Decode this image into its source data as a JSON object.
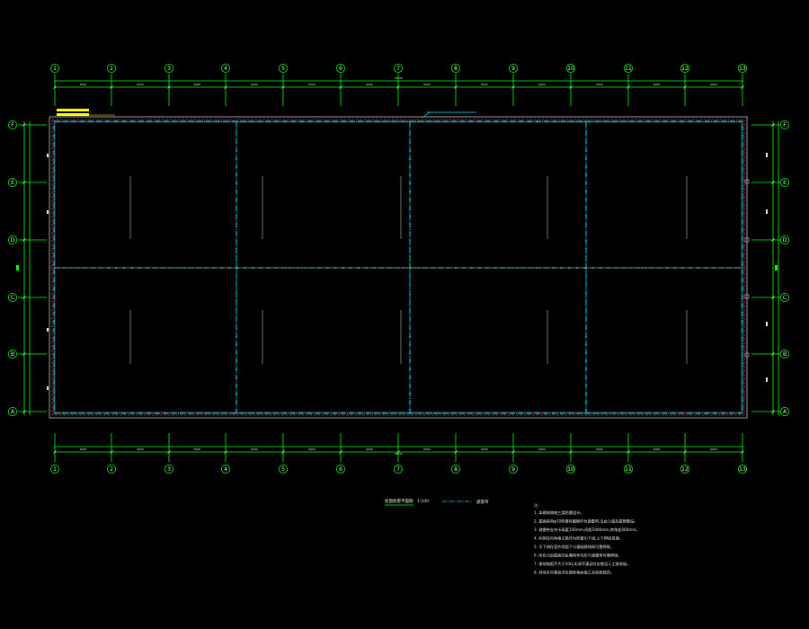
{
  "axes": {
    "columns": [
      "1",
      "2",
      "3",
      "4",
      "5",
      "6",
      "7",
      "8",
      "9",
      "10",
      "11",
      "12",
      "13"
    ],
    "rows": [
      "F",
      "E",
      "D",
      "C",
      "B",
      "A"
    ]
  },
  "dimensions": {
    "top_bays": [
      "6000",
      "6000",
      "6000",
      "6000",
      "6000",
      "6000",
      "6000",
      "6000",
      "6000",
      "6000",
      "6000",
      "6000"
    ],
    "top_total": "72000",
    "bottom_bays": [
      "6000",
      "6000",
      "6000",
      "6000",
      "6000",
      "6000",
      "6000",
      "6000",
      "6000",
      "6000",
      "6000",
      "6000"
    ],
    "bottom_total": "72000"
  },
  "title": {
    "main": "屋面防雷平面图",
    "scale": "1:100"
  },
  "legend": {
    "label": "避雷带"
  },
  "notes": {
    "heading": "注:",
    "lines": [
      "1. 本建筑物按三类防雷设计。",
      "2. 屋面采用φ10热镀锌圆钢作为避雷带,沿女儿墙及屋脊敷设。",
      "3. 避雷带支持卡高度150mm,间距1000mm,转角处500mm。",
      "4. 利用柱内两根主筋作为防雷引下线,上下焊接贯通。",
      "5. 引下线在室外地面下与基础接地网可靠焊接。",
      "6. 所有凸出屋面的金属构件均应与避雷带可靠焊接。",
      "7. 接地电阻不大于10Ω,实测不满足时应增设人工接地极。",
      "8. 其他未尽事宜详见国家相关施工及验收规范。"
    ]
  },
  "colors": {
    "axis": "#00ff00",
    "bubble": "#e8e8e8",
    "lightning": "#00e5ff",
    "wall": "#ff4a8a",
    "highlight": "#ffff00"
  }
}
